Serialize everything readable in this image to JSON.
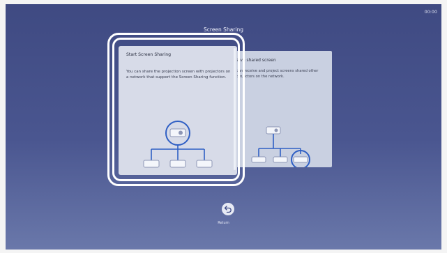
{
  "status": {
    "clock": "00:00"
  },
  "header": {
    "title": "Screen Sharing"
  },
  "cards": [
    {
      "title": "Start Screen Sharing",
      "description": "You can share the projection screen with projectors on a network that support the Screen Sharing function.",
      "icon": "projector-network-source-icon",
      "selected": true
    },
    {
      "title": "eive shared screen",
      "description": "can receive and project screens shared other projectors on the network.",
      "icon": "projector-network-receive-icon",
      "selected": false
    }
  ],
  "footer": {
    "return_label": "Return",
    "return_icon": "return-arrow-icon"
  },
  "colors": {
    "accent": "#2f5fc4",
    "selection": "#ffffff",
    "background": "#46518a"
  }
}
